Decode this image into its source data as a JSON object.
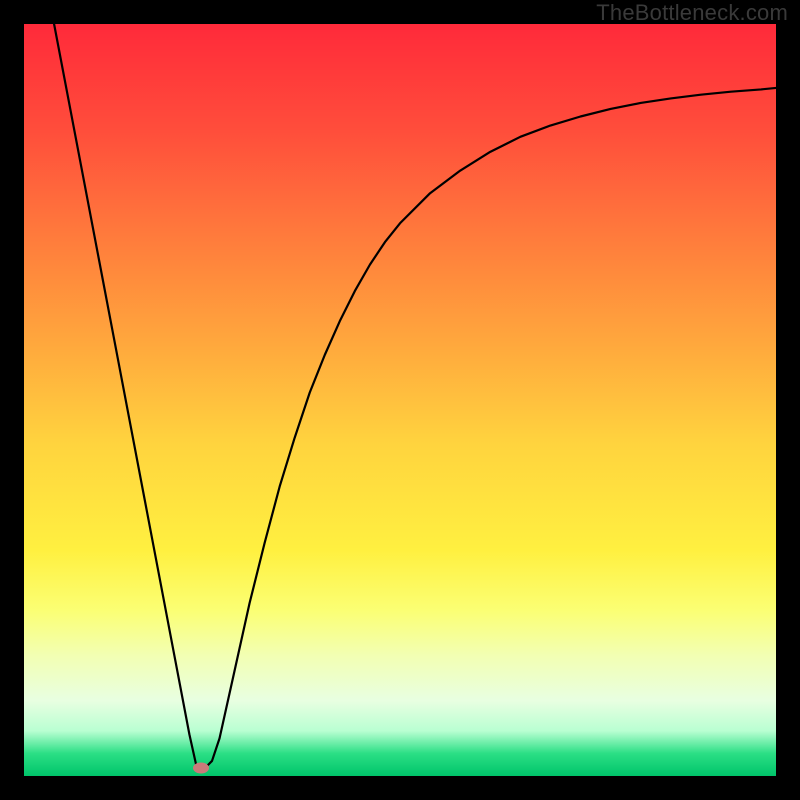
{
  "watermark": "TheBottleneck.com",
  "chart_data": {
    "type": "line",
    "title": "",
    "xlabel": "",
    "ylabel": "",
    "xlim": [
      0,
      100
    ],
    "ylim": [
      0,
      100
    ],
    "grid": false,
    "legend": false,
    "x": [
      4,
      6,
      8,
      10,
      12,
      14,
      16,
      18,
      20,
      22,
      23,
      24,
      25,
      26,
      28,
      30,
      32,
      34,
      36,
      38,
      40,
      42,
      44,
      46,
      48,
      50,
      54,
      58,
      62,
      66,
      70,
      74,
      78,
      82,
      86,
      90,
      94,
      98,
      100
    ],
    "values": [
      100,
      89.5,
      79,
      68.5,
      58,
      47.5,
      37,
      26.5,
      16,
      5.5,
      1,
      1,
      2,
      5,
      14,
      23,
      31,
      38.5,
      45,
      51,
      56,
      60.5,
      64.5,
      68,
      71,
      73.5,
      77.5,
      80.5,
      83,
      85,
      86.5,
      87.7,
      88.7,
      89.5,
      90.1,
      90.6,
      91,
      91.3,
      91.5
    ],
    "marker": {
      "x": 23.5,
      "y": 1
    },
    "gradient_stops": [
      {
        "pos": 0,
        "color": "#ff2a3a"
      },
      {
        "pos": 70,
        "color": "#fff040"
      },
      {
        "pos": 100,
        "color": "#00c46a"
      }
    ]
  }
}
